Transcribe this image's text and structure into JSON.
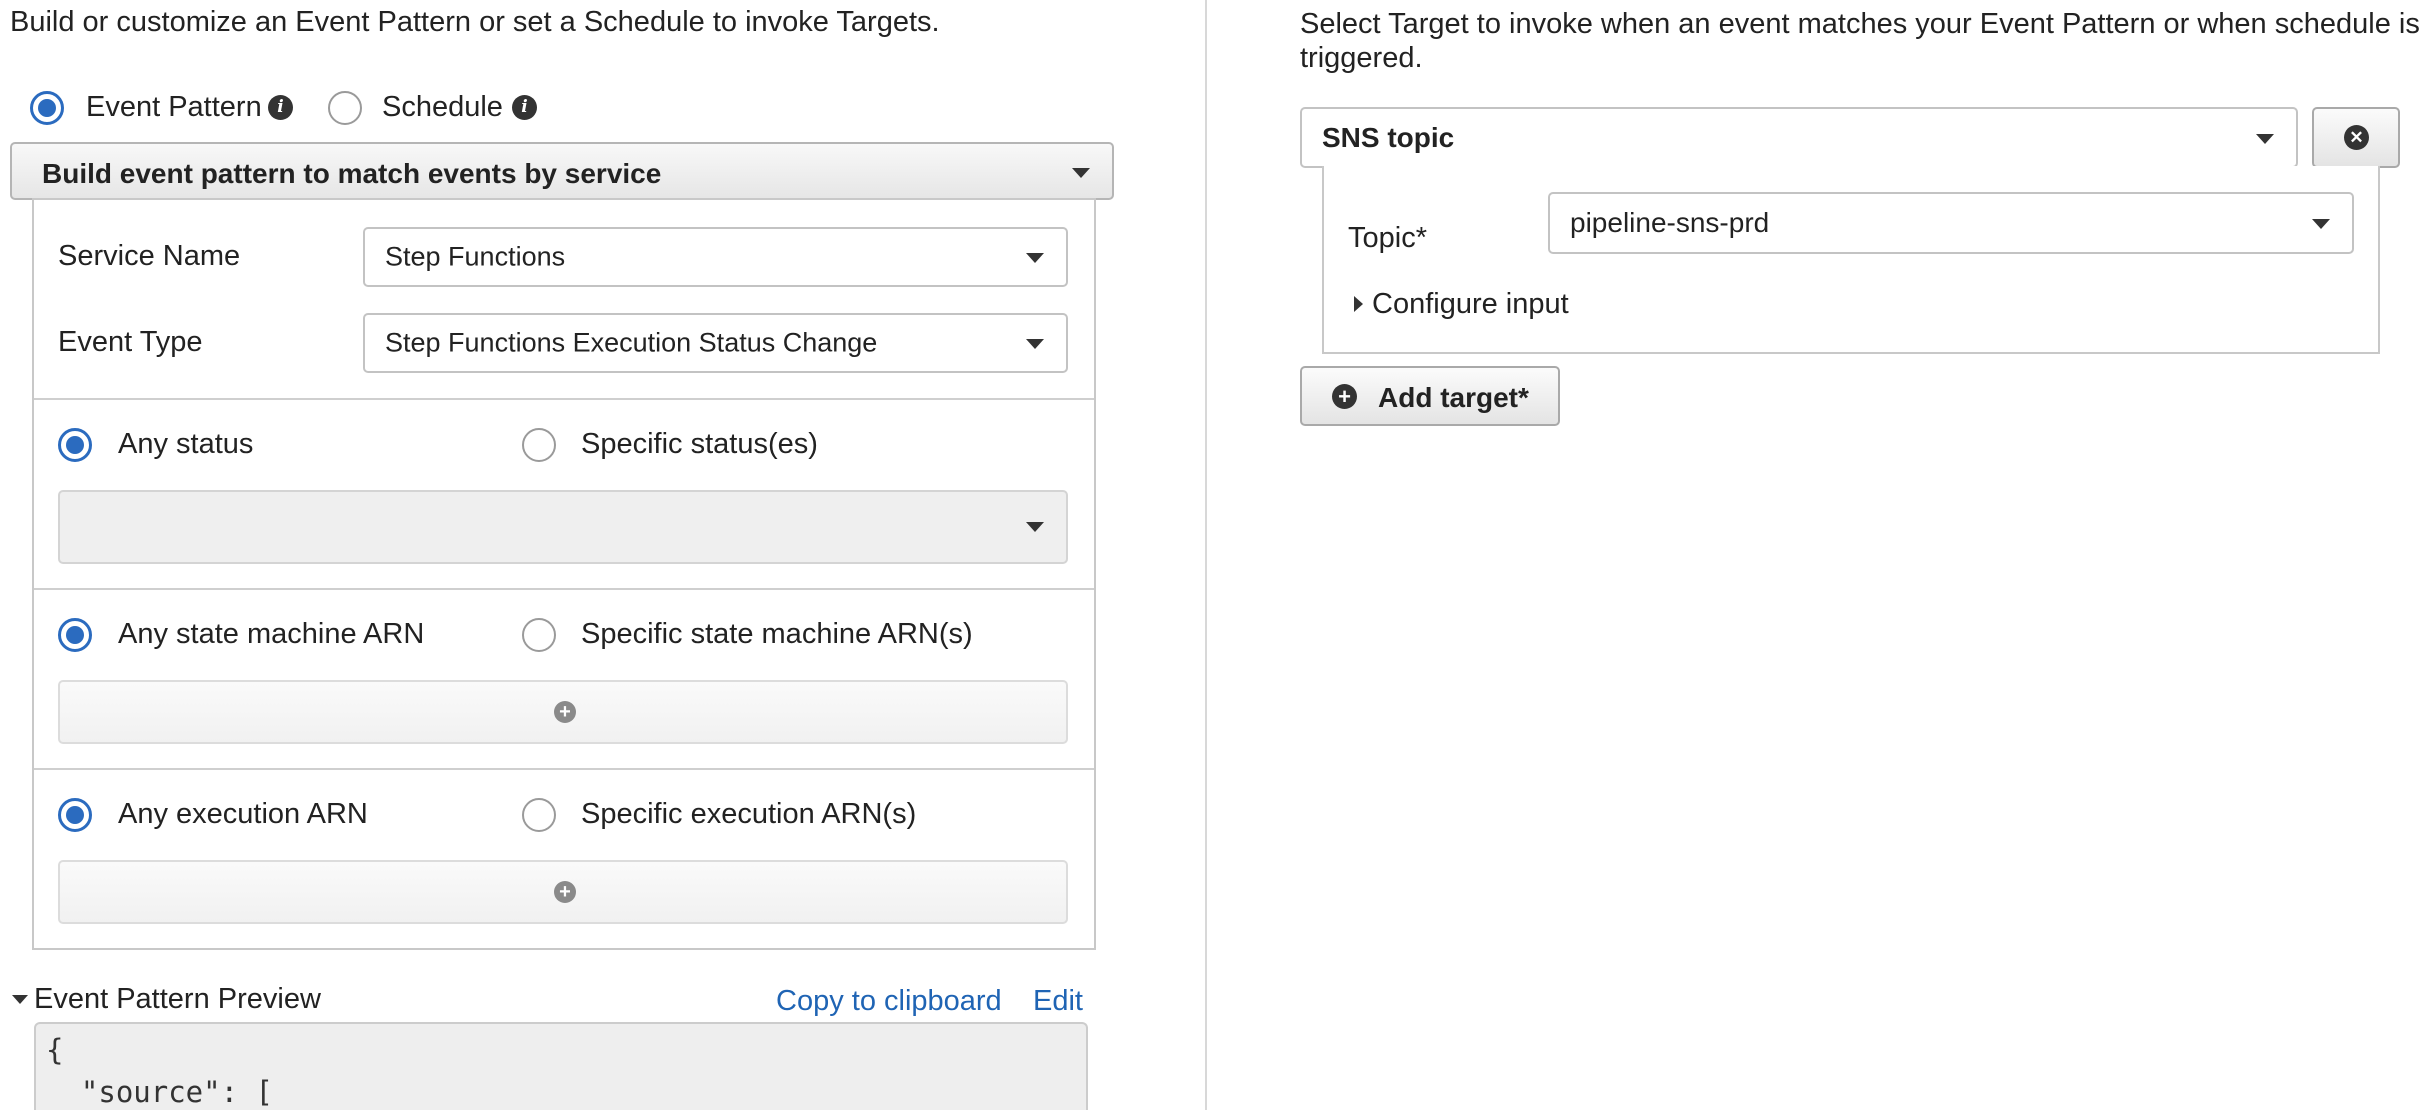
{
  "event_source": {
    "description": "Build or customize an Event Pattern or set a Schedule to invoke Targets.",
    "mode_options": {
      "event_pattern": "Event Pattern",
      "schedule": "Schedule"
    },
    "selected_mode": "Event Pattern",
    "builder_dropdown": "Build event pattern to match events by service",
    "service_name_label": "Service Name",
    "service_name_value": "Step Functions",
    "event_type_label": "Event Type",
    "event_type_value": "Step Functions Execution Status Change",
    "status": {
      "any_label": "Any status",
      "specific_label": "Specific status(es)",
      "selected": "Any status"
    },
    "state_machine": {
      "any_label": "Any state machine ARN",
      "specific_label": "Specific state machine ARN(s)",
      "selected": "Any state machine ARN"
    },
    "execution": {
      "any_label": "Any execution ARN",
      "specific_label": "Specific execution ARN(s)",
      "selected": "Any execution ARN"
    },
    "preview": {
      "title": "Event Pattern Preview",
      "copy_link": "Copy to clipboard",
      "edit_link": "Edit",
      "code_lines": [
        "{",
        "  \"source\": ["
      ]
    }
  },
  "targets": {
    "description_line1": "Select Target to invoke when an event matches your Event Pattern or when schedule is",
    "description_line2": "triggered.",
    "target_type": "SNS topic",
    "topic_label": "Topic*",
    "topic_value": "pipeline-sns-prd",
    "configure_input": "Configure input",
    "add_target": "Add target*"
  },
  "icons": {
    "info": "info-icon",
    "remove": "close-circle-icon",
    "add": "plus-circle-icon",
    "dropdown": "caret-down-icon"
  },
  "colors": {
    "accent": "#2b6bbf",
    "link": "#1f64b4"
  }
}
